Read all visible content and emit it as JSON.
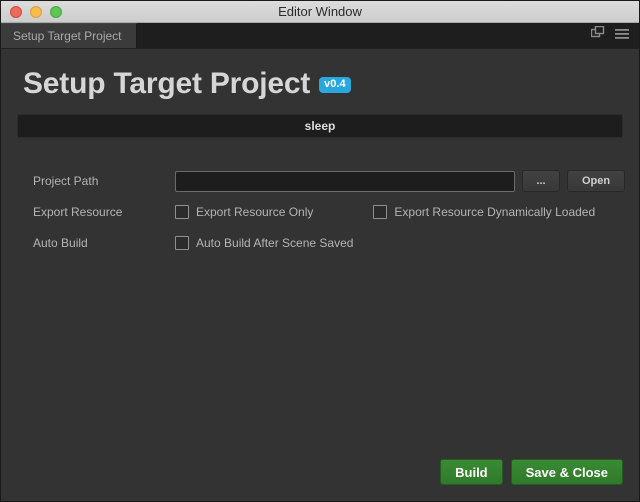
{
  "window": {
    "title": "Editor Window",
    "traffic_lights": [
      {
        "name": "close",
        "color": "#ec6a5f"
      },
      {
        "name": "minimize",
        "color": "#f5bd4f"
      },
      {
        "name": "maximize",
        "color": "#61c554"
      }
    ]
  },
  "tabstrip": {
    "tabs": [
      {
        "label": "Setup Target Project",
        "active": true
      }
    ],
    "icons": [
      {
        "name": "open-in-new-window-icon"
      },
      {
        "name": "hamburger-menu-icon"
      }
    ]
  },
  "header": {
    "title": "Setup Target Project",
    "version": "v0.4",
    "version_color": "#29a8e0"
  },
  "status": {
    "message": "sleep"
  },
  "form": {
    "rows": [
      {
        "label": "Project Path",
        "input": {
          "value": "",
          "placeholder": ""
        },
        "buttons": [
          {
            "label": "...",
            "name": "browse-button"
          },
          {
            "label": "Open",
            "name": "open-button"
          }
        ]
      },
      {
        "label": "Export Resource",
        "checkboxes": [
          {
            "label": "Export Resource Only",
            "checked": false
          },
          {
            "label": "Export Resource Dynamically Loaded",
            "checked": false
          }
        ]
      },
      {
        "label": "Auto Build",
        "checkboxes": [
          {
            "label": "Auto Build After Scene Saved",
            "checked": false
          }
        ]
      }
    ]
  },
  "footer": {
    "build_label": "Build",
    "save_close_label": "Save & Close",
    "accent_color": "#36842f"
  }
}
